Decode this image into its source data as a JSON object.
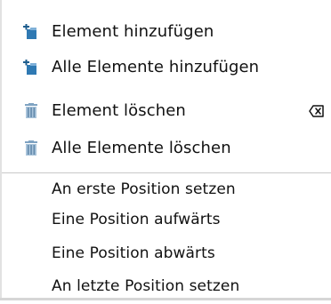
{
  "context_menu": {
    "items": [
      {
        "label": "Element hinzufügen",
        "icon": "add-item-icon",
        "shortcut_icon": null
      },
      {
        "label": "Alle Elemente hinzufügen",
        "icon": "add-all-items-icon",
        "shortcut_icon": null
      },
      {
        "label": "Element löschen",
        "icon": "trash-icon",
        "shortcut_icon": "delete-key-icon"
      },
      {
        "label": "Alle Elemente löschen",
        "icon": "trash-all-icon",
        "shortcut_icon": null
      }
    ],
    "position_items": [
      {
        "label": "An erste Position setzen"
      },
      {
        "label": "Eine Position aufwärts"
      },
      {
        "label": "Eine Position abwärts"
      },
      {
        "label": "An letzte Position setzen"
      }
    ]
  },
  "colors": {
    "add_icon_blue": "#2f79b3",
    "add_icon_plus": "#1f5e8e",
    "trash_icon_blue": "#7fa3c2",
    "text": "#111111",
    "divider": "#c9c9c9"
  }
}
